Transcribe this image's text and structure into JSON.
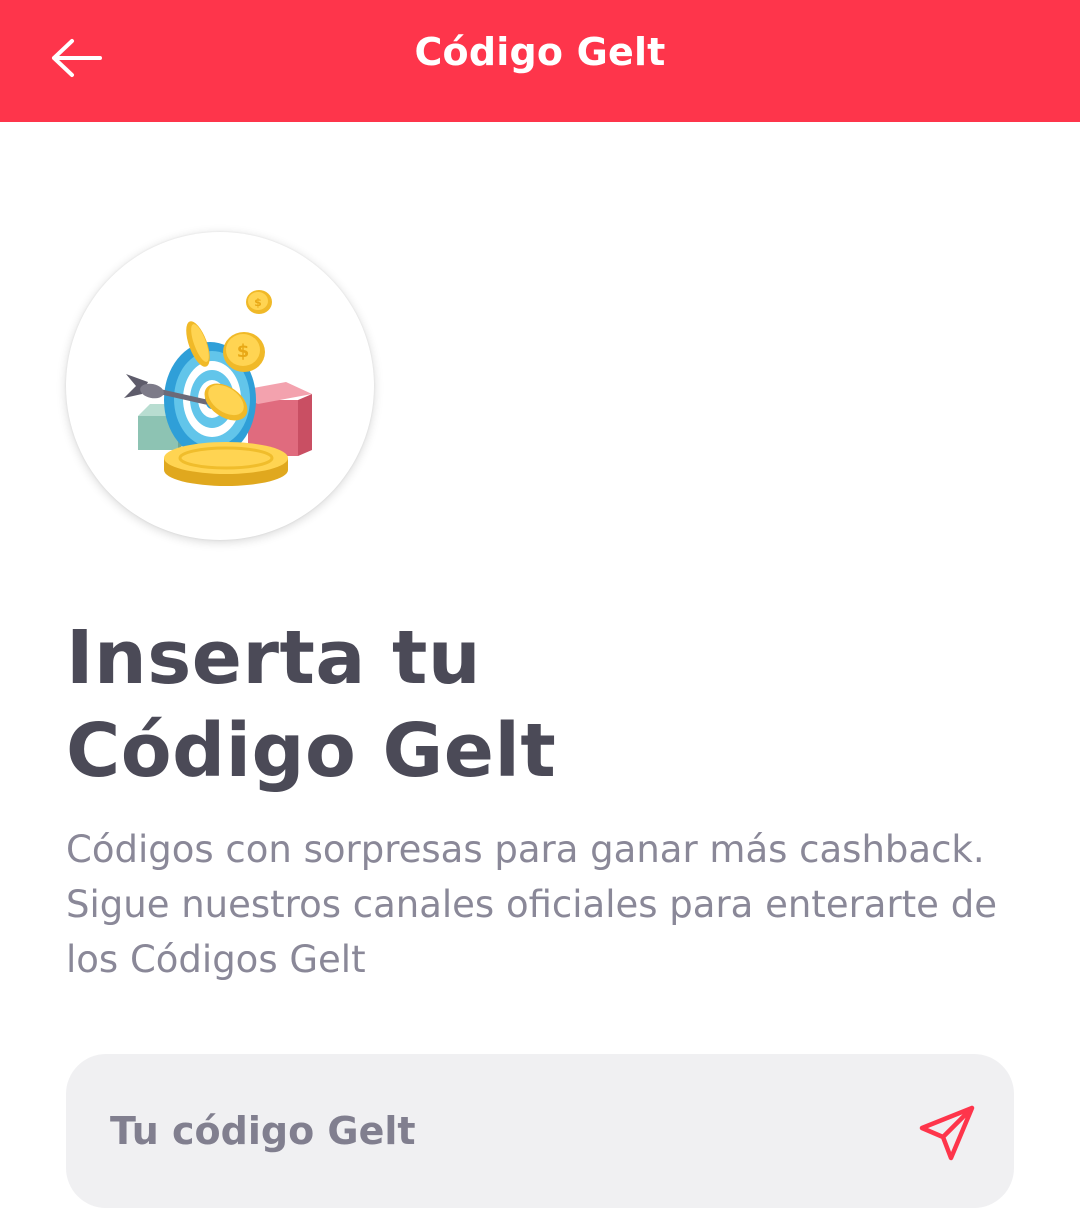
{
  "app_bar": {
    "title": "Código Gelt",
    "back_icon": "arrow-left-icon"
  },
  "illustration": {
    "name": "target-coins-illustration"
  },
  "content": {
    "heading_line1": "Inserta tu",
    "heading_line2": "Código Gelt",
    "description": "Códigos con sorpresas para ganar más cashback. Sigue nuestros canales oficiales para enterarte de los Códigos Gelt"
  },
  "code_form": {
    "input_value": "",
    "input_placeholder": "Tu código Gelt",
    "send_icon": "send-paper-plane-icon"
  },
  "colors": {
    "brand": "#fe354b",
    "heading": "#4b4a57",
    "body_text": "#8a8898",
    "field_background": "#f0f0f2"
  }
}
